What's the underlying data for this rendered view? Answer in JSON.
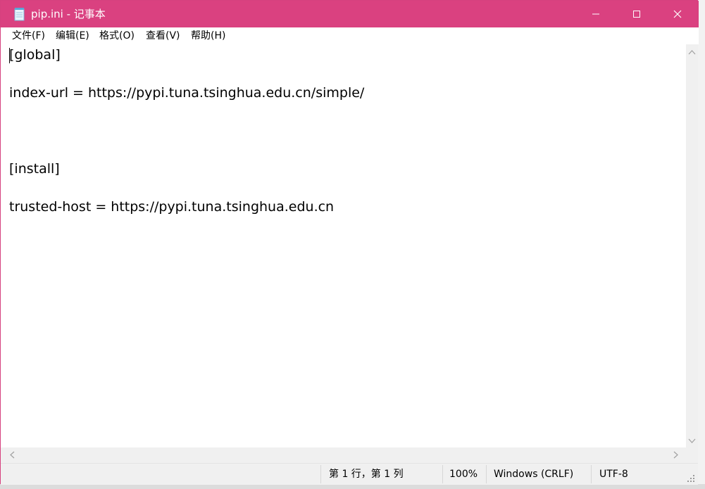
{
  "window": {
    "title": "pip.ini - 记事本",
    "icon": "notepad-icon",
    "accent_color": "#da4180"
  },
  "menu": {
    "items": [
      {
        "label": "文件(F)"
      },
      {
        "label": "编辑(E)"
      },
      {
        "label": "格式(O)"
      },
      {
        "label": "查看(V)"
      },
      {
        "label": "帮助(H)"
      }
    ]
  },
  "editor": {
    "lines": [
      "[global]",
      "",
      "index-url = https://pypi.tuna.tsinghua.edu.cn/simple/",
      "",
      "",
      "",
      "[install]",
      "",
      "trusted-host = https://pypi.tuna.tsinghua.edu.cn"
    ]
  },
  "status": {
    "position": "第 1 行，第 1 列",
    "zoom": "100%",
    "line_ending": "Windows (CRLF)",
    "encoding": "UTF-8"
  },
  "controls": {
    "minimize_icon": "minimize-icon",
    "maximize_icon": "maximize-icon",
    "close_icon": "close-icon"
  }
}
